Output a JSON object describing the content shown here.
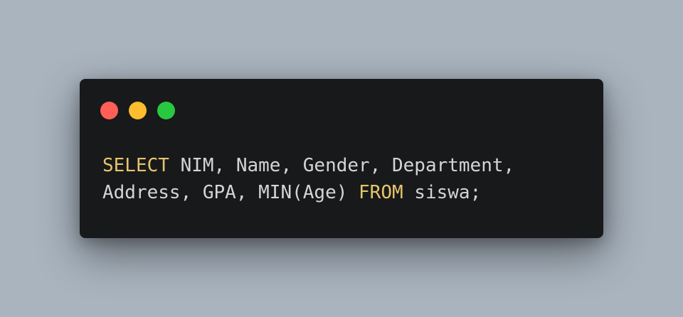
{
  "window": {
    "dots": [
      {
        "name": "close",
        "color": "#ff5f57"
      },
      {
        "name": "minimize",
        "color": "#febc2e"
      },
      {
        "name": "maximize",
        "color": "#28c840"
      }
    ]
  },
  "code": {
    "line1": {
      "kw_select": "SELECT",
      "rest": " NIM, Name, Gender, Department,"
    },
    "line2": {
      "pre": "Address, GPA, MIN(Age) ",
      "kw_from": "FROM",
      "post": " siswa;"
    },
    "keyword_color": "#e6c56a",
    "text_color": "#d4d4d4",
    "background": "#18191b"
  }
}
